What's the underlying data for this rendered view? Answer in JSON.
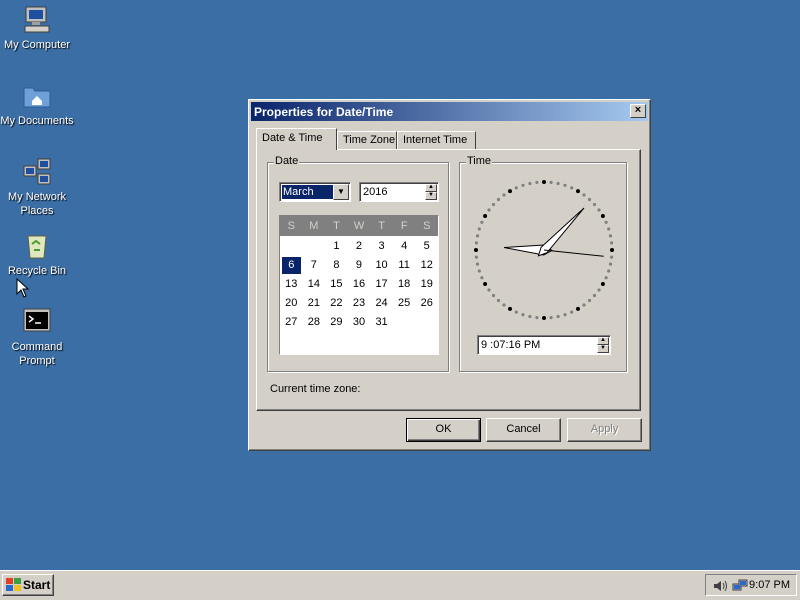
{
  "desktop": {
    "icons": [
      {
        "label": "My Computer"
      },
      {
        "label": "My Documents"
      },
      {
        "label": "My Network Places"
      },
      {
        "label": "Recycle Bin"
      },
      {
        "label": "Command Prompt"
      }
    ]
  },
  "window": {
    "title": "Properties for Date/Time",
    "close": "×",
    "tabs": [
      "Date & Time",
      "Time Zone",
      "Internet Time"
    ],
    "date_group": "Date",
    "time_group": "Time",
    "month": "March",
    "year": "2016",
    "day_headers": [
      "S",
      "M",
      "T",
      "W",
      "T",
      "F",
      "S"
    ],
    "selected_day": "6",
    "time_value": "9 :07:16 PM",
    "timezone_label": "Current time zone:",
    "ok": "OK",
    "cancel": "Cancel",
    "apply": "Apply",
    "clock": {
      "hour": 9,
      "minute": 7,
      "second": 16
    }
  },
  "taskbar": {
    "start": "Start",
    "time": "9:07 PM"
  },
  "colors": {
    "desktop": "#3a6ea5",
    "selection": "#0a246a",
    "face": "#d4d0c8"
  }
}
